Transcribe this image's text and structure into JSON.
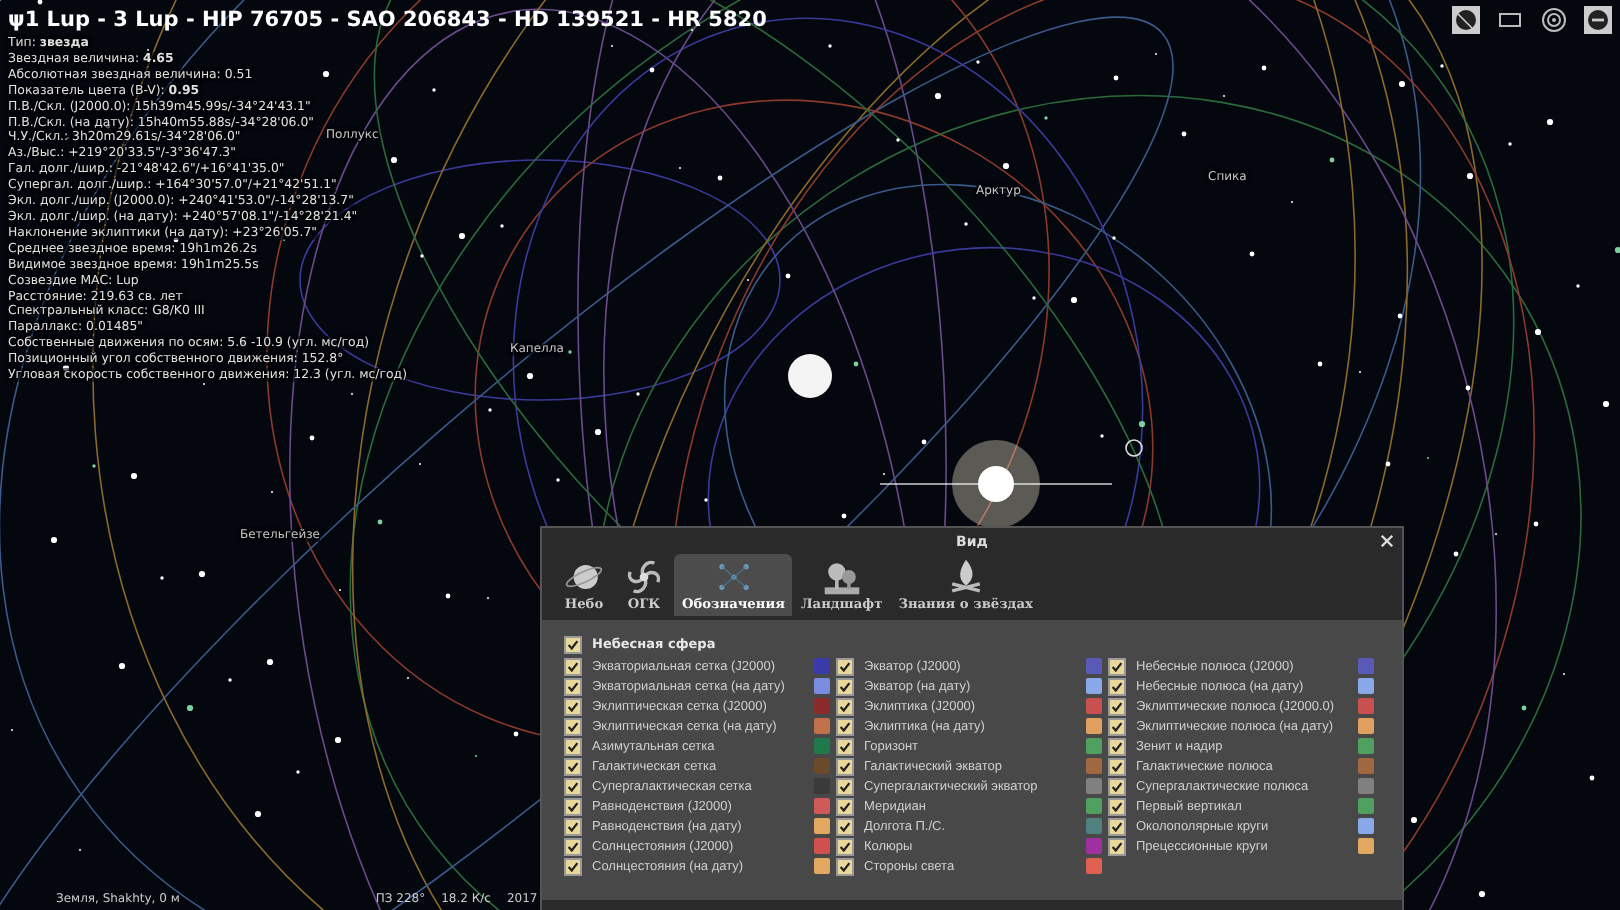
{
  "info": {
    "title": "ψ1 Lup - 3 Lup - HIP 76705 - SAO 206843 - HD 139521 - HR 5820",
    "lines": [
      "Тип: **звезда**",
      "Звездная величина: **4.65**",
      "Абсолютная звездная величина: 0.51",
      "Показатель цвета (B-V): **0.95**",
      "П.В./Скл. (J2000.0): 15h39m45.99s/-34°24'43.1\"",
      "П.В./Скл. (на дату): 15h40m55.88s/-34°28'06.0\"",
      "Ч.У./Скл.: 3h20m29.61s/-34°28'06.0\"",
      "Аз./Выс.: +219°20'33.5\"/-3°36'47.3\"",
      "Гал. долг./шир.: -21°48'42.6\"/+16°41'35.0\"",
      "Супергал. долг./шир.: +164°30'57.0\"/+21°42'51.1\"",
      "Экл. долг./шир. (J2000.0): +240°41'53.0\"/-14°28'13.7\"",
      "Экл. долг./шир. (на дату): +240°57'08.1\"/-14°28'21.4\"",
      "Наклонение эклиптики (на дату): +23°26'05.7\"",
      "Среднее звездное время: 19h1m26.2s",
      "Видимое звездное время: 19h1m25.5s",
      "Созвездие МАС: Lup",
      "Расстояние: 219.63 св. лет",
      "Спектральный класс: G8/K0 III",
      "Параллакс: 0.01485\"",
      "Собственные движения по осям: 5.6 -10.9 (угл. мс/год)",
      "Позиционный угол собственного движения: 152.8°",
      "Угловая скорость собственного движения: 12.3 (угл. мс/год)"
    ]
  },
  "sky_labels": [
    "Поллукс",
    "Арктур",
    "Спика",
    "Капелла",
    "Бетельгейзе"
  ],
  "dialog": {
    "title": "Вид",
    "tabs": [
      {
        "label": "Небо",
        "selected": false,
        "kind": "planet"
      },
      {
        "label": "ОГК",
        "selected": false,
        "kind": "galaxy"
      },
      {
        "label": "Обозначения",
        "selected": true,
        "kind": "grid"
      },
      {
        "label": "Ландшафт",
        "selected": false,
        "kind": "trees"
      },
      {
        "label": "Знания о звёздах",
        "selected": false,
        "kind": "fire"
      }
    ],
    "group": {
      "label": "Небесная сфера",
      "checked": true
    },
    "columns": [
      [
        {
          "label": "Экваториальная сетка (J2000)",
          "checked": true,
          "color": "#3a3aa8"
        },
        {
          "label": "Экваториальная сетка (на дату)",
          "checked": true,
          "color": "#7a8ce0"
        },
        {
          "label": "Эклиптическая сетка (J2000)",
          "checked": true,
          "color": "#8a2a2a"
        },
        {
          "label": "Эклиптическая сетка (на дату)",
          "checked": true,
          "color": "#c0704a"
        },
        {
          "label": "Азимутальная сетка",
          "checked": true,
          "color": "#1e7a4a"
        },
        {
          "label": "Галактическая сетка",
          "checked": true,
          "color": "#6a4a2a"
        },
        {
          "label": "Супергалактическая сетка",
          "checked": true,
          "color": "#3a3a3a"
        },
        {
          "label": "Равноденствия (J2000)",
          "checked": true,
          "color": "#d05a5a"
        },
        {
          "label": "Равноденствия (на дату)",
          "checked": true,
          "color": "#e0a860"
        },
        {
          "label": "Солнцестояния (J2000)",
          "checked": true,
          "color": "#d05050"
        },
        {
          "label": "Солнцестояния (на дату)",
          "checked": true,
          "color": "#e0a860"
        }
      ],
      [
        {
          "label": "Экватор (J2000)",
          "checked": true,
          "color": "#5a5ab8"
        },
        {
          "label": "Экватор (на дату)",
          "checked": true,
          "color": "#8aa8e8"
        },
        {
          "label": "Эклиптика (J2000)",
          "checked": true,
          "color": "#c85050"
        },
        {
          "label": "Эклиптика (на дату)",
          "checked": true,
          "color": "#e0a060"
        },
        {
          "label": "Горизонт",
          "checked": true,
          "color": "#50a060"
        },
        {
          "label": "Галактический экватор",
          "checked": true,
          "color": "#a06840"
        },
        {
          "label": "Супергалактический экватор",
          "checked": true,
          "color": "#808080"
        },
        {
          "label": "Меридиан",
          "checked": true,
          "color": "#50a060"
        },
        {
          "label": "Долгота П./С.",
          "checked": true,
          "color": "#508080"
        },
        {
          "label": "Колюры",
          "checked": true,
          "color": "#a030a0"
        },
        {
          "label": "Стороны света",
          "checked": true,
          "color": "#e06050"
        }
      ],
      [
        {
          "label": "Небесные полюса (J2000)",
          "checked": true,
          "color": "#5a5ab8"
        },
        {
          "label": "Небесные полюса (на дату)",
          "checked": true,
          "color": "#8aa8e8"
        },
        {
          "label": "Эклиптические полюса (J2000.0)",
          "checked": true,
          "color": "#c85050"
        },
        {
          "label": "Эклиптические полюса (на дату)",
          "checked": true,
          "color": "#e0a060"
        },
        {
          "label": "Зенит и надир",
          "checked": true,
          "color": "#50a060"
        },
        {
          "label": "Галактические полюса",
          "checked": true,
          "color": "#a06840"
        },
        {
          "label": "Супергалактические полюса",
          "checked": true,
          "color": "#808080"
        },
        {
          "label": "Первый вертикал",
          "checked": true,
          "color": "#50a060"
        },
        {
          "label": "Околополярные круги",
          "checked": true,
          "color": "#8aa8e8"
        },
        {
          "label": "Прецессионные круги",
          "checked": true,
          "color": "#e0a860"
        }
      ]
    ]
  },
  "status_bar": {
    "location": "Земля, Shakhty, 0 м",
    "fov": "ПЗ 228°",
    "fps": "18.2 К/с",
    "date": "2017"
  }
}
